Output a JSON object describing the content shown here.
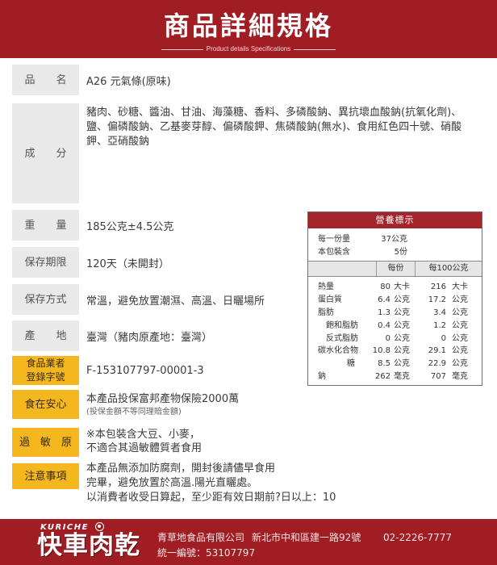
{
  "colors": {
    "brand_red": "#a11d24",
    "label_gray": "#e9e9e9",
    "highlight_yellow": "#f4b81e",
    "text": "#3a3a3a"
  },
  "header": {
    "title": "商品詳細規格",
    "subtitle": "Product details Specifications"
  },
  "specs": {
    "name": {
      "label": "品　　名",
      "value": "A26 元氣條(原味)"
    },
    "ingredients": {
      "label": "成　　分",
      "value": "豬肉、砂糖、醬油、甘油、海藻糖、香料、多磷酸鈉、異抗壞血酸鈉(抗氧化劑)、鹽、偏磷酸鈉、乙基麥芽醇、偏磷酸鉀、焦磷酸鈉(無水)、食用紅色四十號、硝酸鉀、亞硝酸鈉"
    },
    "weight": {
      "label": "重　　量",
      "value": "185公克±4.5公克"
    },
    "shelf_life": {
      "label": "保存期限",
      "value": "120天（未開封）"
    },
    "storage": {
      "label": "保存方式",
      "value": "常溫，避免放置潮濕、高溫、日曬場所"
    },
    "origin": {
      "label": "產　　地",
      "value": "臺灣（豬肉原產地：臺灣）"
    },
    "registration": {
      "label": "食品業者登錄字號",
      "value": "F-153107797-00001-3"
    },
    "insurance": {
      "label": "食在安心",
      "value": "本產品投保富邦產物保險2000萬",
      "note": "(投保金額不等同理賠金額)"
    },
    "allergen": {
      "label": "過　敏　原",
      "lines": [
        "※本包裝含大豆、小麥，",
        "不適合其過敏體質者食用"
      ]
    },
    "notice": {
      "label": "注意事項",
      "lines": [
        "本產品無添加防腐劑，開封後請儘早食用",
        "完畢，避免放置於高溫.陽光直曬處。",
        "以消費者收受日算起，至少距有效日期前?日以上：10"
      ]
    }
  },
  "nutrition": {
    "title": "營養標示",
    "serving_size_label": "每一份量",
    "serving_size_value": "37公克",
    "servings_label": "本包裝含",
    "servings_value": "5份",
    "col_per_serving": "每份",
    "col_per_100g": "每100公克",
    "rows": [
      {
        "name": "熱量",
        "per_serving": "80",
        "per_serving_unit": "大卡",
        "per_100g": "216",
        "per_100g_unit": "大卡"
      },
      {
        "name": "蛋白質",
        "per_serving": "6.4",
        "per_serving_unit": "公克",
        "per_100g": "17.2",
        "per_100g_unit": "公克"
      },
      {
        "name": "脂肪",
        "per_serving": "1.3",
        "per_serving_unit": "公克",
        "per_100g": "3.4",
        "per_100g_unit": "公克"
      },
      {
        "name": "飽和脂肪",
        "per_serving": "0.4",
        "per_serving_unit": "公克",
        "per_100g": "1.2",
        "per_100g_unit": "公克"
      },
      {
        "name": "反式脂肪",
        "per_serving": "0",
        "per_serving_unit": "公克",
        "per_100g": "0",
        "per_100g_unit": "公克"
      },
      {
        "name": "碳水化合物",
        "per_serving": "10.8",
        "per_serving_unit": "公克",
        "per_100g": "29.1",
        "per_100g_unit": "公克"
      },
      {
        "name": "糖",
        "per_serving": "8.5",
        "per_serving_unit": "公克",
        "per_100g": "22.9",
        "per_100g_unit": "公克"
      },
      {
        "name": "鈉",
        "per_serving": "262",
        "per_serving_unit": "毫克",
        "per_100g": "707",
        "per_100g_unit": "毫克"
      }
    ]
  },
  "footer": {
    "brand_en": "KURICHE",
    "brand_zh": "快車肉乾",
    "logo_icon": "logo-emblem-icon",
    "company": "青草地食品有限公司",
    "address": "新北市中和區建一路92號",
    "phone": "02-2226-7777",
    "tax_id": "統一編號：53107797"
  }
}
